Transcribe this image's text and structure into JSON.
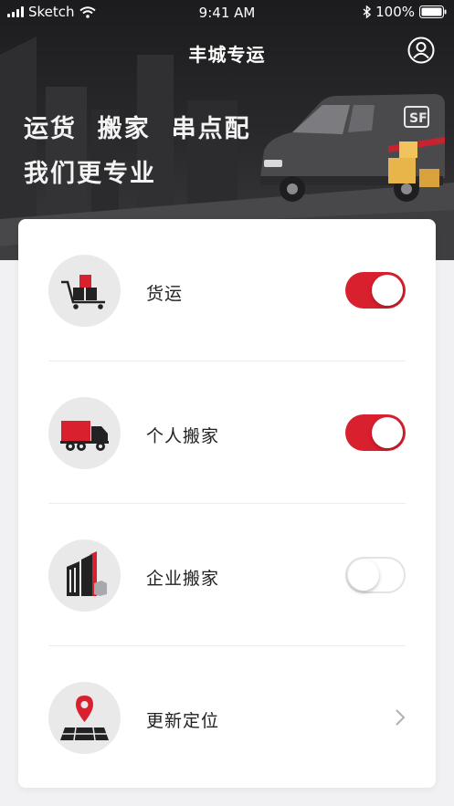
{
  "status_bar": {
    "carrier": "Sketch",
    "time": "9:41 AM",
    "battery": "100%"
  },
  "header": {
    "title": "丰城专运",
    "user_icon": "user-circle-icon"
  },
  "banner": {
    "slogan_line1": "运货  搬家  串点配",
    "slogan_line2": "我们更专业",
    "van_logo_text": "SF"
  },
  "menu": {
    "items": [
      {
        "label": "货运",
        "icon": "cart-boxes-icon",
        "control": "toggle",
        "enabled": true
      },
      {
        "label": "个人搬家",
        "icon": "truck-icon",
        "control": "toggle",
        "enabled": true
      },
      {
        "label": "企业搬家",
        "icon": "building-icon",
        "control": "toggle",
        "enabled": false
      },
      {
        "label": "更新定位",
        "icon": "location-pin-icon",
        "control": "chevron"
      }
    ]
  },
  "colors": {
    "accent": "#d8202f",
    "hero_dark": "#1c1c1e",
    "page_bg": "#f1f1f3"
  }
}
